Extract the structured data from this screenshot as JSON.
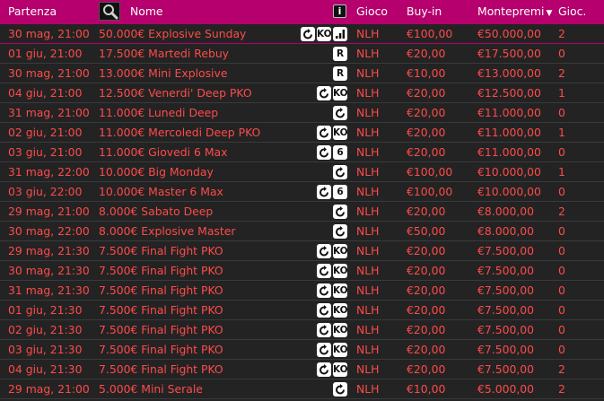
{
  "header": {
    "col_start": "Partenza",
    "col_name": "Nome",
    "col_info": "i",
    "col_game": "Gioco",
    "col_buyin": "Buy-in",
    "col_prize": "Montepremi",
    "col_prize_sort": "▼",
    "col_players": "Gioc."
  },
  "colors": {
    "header_bg": "#b5006d",
    "row_text": "#ff4a4a",
    "row_bg": "#232323",
    "badge_bg": "#ffffff"
  },
  "rows": [
    {
      "start": "30 mag, 21:00",
      "name": "50.000€ Explosive Sunday",
      "badges": [
        "rebuy",
        "KO",
        "chart"
      ],
      "game": "NLH",
      "buyin": "€100,00",
      "prize": "€50.000,00",
      "players": "2"
    },
    {
      "start": "01 giu, 21:00",
      "name": "17.500€ Martedi Rebuy",
      "badges": [
        "R"
      ],
      "game": "NLH",
      "buyin": "€20,00",
      "prize": "€17.500,00",
      "players": "0"
    },
    {
      "start": "30 mag, 21:00",
      "name": "13.000€ Mini Explosive",
      "badges": [
        "R"
      ],
      "game": "NLH",
      "buyin": "€10,00",
      "prize": "€13.000,00",
      "players": "2"
    },
    {
      "start": "04 giu, 21:00",
      "name": "12.500€ Venerdi' Deep PKO",
      "badges": [
        "rebuy",
        "KO"
      ],
      "game": "NLH",
      "buyin": "€20,00",
      "prize": "€12.500,00",
      "players": "1"
    },
    {
      "start": "31 mag, 21:00",
      "name": "11.000€ Lunedi Deep",
      "badges": [
        "rebuy"
      ],
      "game": "NLH",
      "buyin": "€20,00",
      "prize": "€11.000,00",
      "players": "0"
    },
    {
      "start": "02 giu, 21:00",
      "name": "11.000€ Mercoledi Deep PKO",
      "badges": [
        "rebuy",
        "KO"
      ],
      "game": "NLH",
      "buyin": "€20,00",
      "prize": "€11.000,00",
      "players": "1"
    },
    {
      "start": "03 giu, 21:00",
      "name": "11.000€ Giovedi 6 Max",
      "badges": [
        "rebuy",
        "6"
      ],
      "game": "NLH",
      "buyin": "€20,00",
      "prize": "€11.000,00",
      "players": "0"
    },
    {
      "start": "31 mag, 22:00",
      "name": "10.000€ Big Monday",
      "badges": [
        "rebuy"
      ],
      "game": "NLH",
      "buyin": "€100,00",
      "prize": "€10.000,00",
      "players": "1"
    },
    {
      "start": "03 giu, 22:00",
      "name": "10.000€ Master 6 Max",
      "badges": [
        "rebuy",
        "6"
      ],
      "game": "NLH",
      "buyin": "€100,00",
      "prize": "€10.000,00",
      "players": "0"
    },
    {
      "start": "29 mag, 21:00",
      "name": "8.000€ Sabato Deep",
      "badges": [
        "rebuy"
      ],
      "game": "NLH",
      "buyin": "€20,00",
      "prize": "€8.000,00",
      "players": "2"
    },
    {
      "start": "30 mag, 22:00",
      "name": "8.000€ Explosive Master",
      "badges": [
        "rebuy"
      ],
      "game": "NLH",
      "buyin": "€50,00",
      "prize": "€8.000,00",
      "players": "0"
    },
    {
      "start": "29 mag, 21:30",
      "name": "7.500€ Final Fight PKO",
      "badges": [
        "rebuy",
        "KO"
      ],
      "game": "NLH",
      "buyin": "€20,00",
      "prize": "€7.500,00",
      "players": "0"
    },
    {
      "start": "30 mag, 21:30",
      "name": "7.500€ Final Fight PKO",
      "badges": [
        "rebuy",
        "KO"
      ],
      "game": "NLH",
      "buyin": "€20,00",
      "prize": "€7.500,00",
      "players": "0"
    },
    {
      "start": "31 mag, 21:30",
      "name": "7.500€ Final Fight PKO",
      "badges": [
        "rebuy",
        "KO"
      ],
      "game": "NLH",
      "buyin": "€20,00",
      "prize": "€7.500,00",
      "players": "0"
    },
    {
      "start": "01 giu, 21:30",
      "name": "7.500€ Final Fight PKO",
      "badges": [
        "rebuy",
        "KO"
      ],
      "game": "NLH",
      "buyin": "€20,00",
      "prize": "€7.500,00",
      "players": "0"
    },
    {
      "start": "02 giu, 21:30",
      "name": "7.500€ Final Fight PKO",
      "badges": [
        "rebuy",
        "KO"
      ],
      "game": "NLH",
      "buyin": "€20,00",
      "prize": "€7.500,00",
      "players": "0"
    },
    {
      "start": "03 giu, 21:30",
      "name": "7.500€ Final Fight PKO",
      "badges": [
        "rebuy",
        "KO"
      ],
      "game": "NLH",
      "buyin": "€20,00",
      "prize": "€7.500,00",
      "players": "0"
    },
    {
      "start": "04 giu, 21:30",
      "name": "7.500€ Final Fight PKO",
      "badges": [
        "rebuy",
        "KO"
      ],
      "game": "NLH",
      "buyin": "€20,00",
      "prize": "€7.500,00",
      "players": "2"
    },
    {
      "start": "29 mag, 21:00",
      "name": "5.000€ Mini Serale",
      "badges": [
        "rebuy"
      ],
      "game": "NLH",
      "buyin": "€10,00",
      "prize": "€5.000,00",
      "players": "2"
    }
  ]
}
